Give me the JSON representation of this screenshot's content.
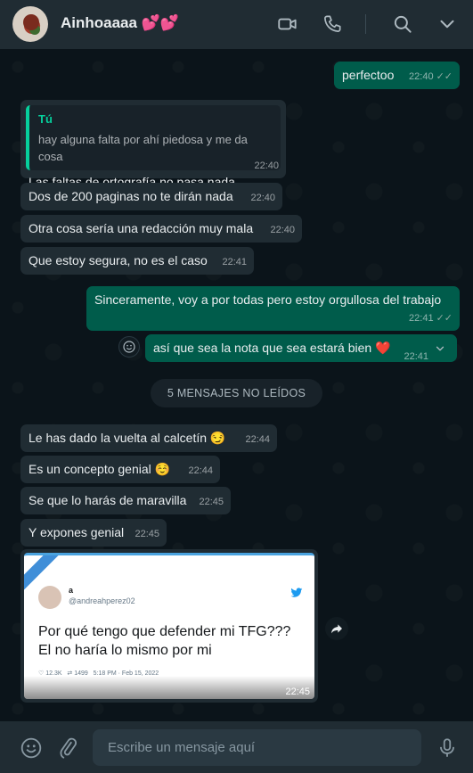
{
  "header": {
    "contact_name": "Ainhoaaaa 💕💕",
    "icons": [
      "avatar",
      "video-call-icon",
      "voice-call-icon",
      "search-icon",
      "chevron-down-icon"
    ]
  },
  "messages": {
    "m1": {
      "text": "perfectoo",
      "time": "22:40",
      "direction": "outgoing",
      "status": "read"
    },
    "m2": {
      "quote_author": "Tú",
      "quote_text": "hay alguna falta por ahí piedosa y me da cosa",
      "text": "Las faltas de ortografía no pasa nada",
      "time": "22:40"
    },
    "m3": {
      "text": "Dos de 200 paginas no te dirán nada",
      "time": "22:40"
    },
    "m4": {
      "text": "Otra cosa sería una redacción muy mala",
      "time": "22:40"
    },
    "m5": {
      "text": "Que estoy segura, no es el caso",
      "time": "22:41"
    },
    "m6": {
      "text": "Sinceramente, voy a por todas pero estoy orgullosa del trabajo",
      "time": "22:41",
      "direction": "outgoing",
      "status": "read"
    },
    "m7": {
      "text": "así que sea la nota que sea estará bien ❤️",
      "time": "22:41",
      "direction": "outgoing"
    },
    "unread_divider": "5 MENSAJES NO LEÍDOS",
    "m8": {
      "text": "Le has dado la vuelta al calcetín 😏",
      "time": "22:44"
    },
    "m9": {
      "text": "Es un concepto genial ☺️",
      "time": "22:44"
    },
    "m10": {
      "text": "Se que lo harás de maravilla",
      "time": "22:45"
    },
    "m11": {
      "text": "Y expones genial",
      "time": "22:45"
    },
    "image": {
      "time": "22:45",
      "tweet_name": "a",
      "tweet_handle": "@andreahperez02",
      "tweet_text": "Por qué tengo que defender mi TFG??? El no haría lo mismo por mi",
      "tweet_likes": "12.3K",
      "tweet_retweets": "1499",
      "tweet_date": "5:18 PM · Feb 15, 2022"
    }
  },
  "composer": {
    "placeholder": "Escribe un mensaje aquí",
    "icons": [
      "emoji-icon",
      "attach-icon",
      "microphone-icon"
    ]
  },
  "colors": {
    "background": "#0b141a",
    "header": "#202c33",
    "incoming_bubble": "#202c33",
    "outgoing_bubble": "#005c4b",
    "accent": "#06cf9c"
  }
}
